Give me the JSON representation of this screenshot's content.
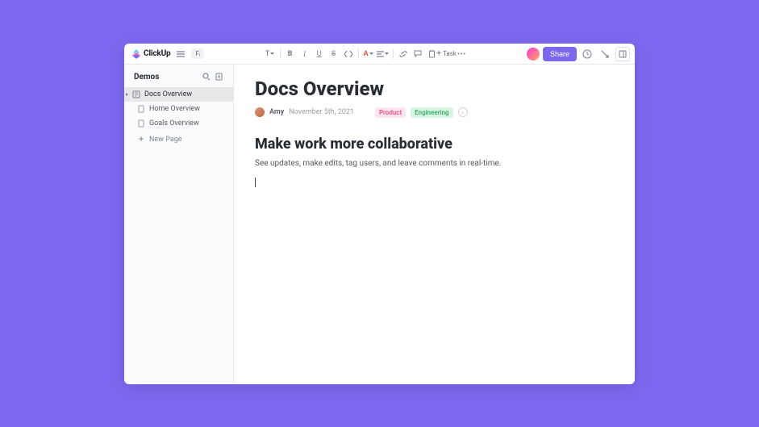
{
  "brand": {
    "name": "ClickUp"
  },
  "topbar": {
    "pill": "Fᵢ",
    "task_label": "Task",
    "share_label": "Share"
  },
  "sidebar": {
    "title": "Demos",
    "items": [
      {
        "label": "Docs Overview",
        "type": "doc",
        "active": true,
        "caret": true
      },
      {
        "label": "Home Overview",
        "type": "page",
        "active": false,
        "caret": false
      },
      {
        "label": "Goals Overview",
        "type": "page",
        "active": false,
        "caret": false
      }
    ],
    "new_label": "New Page"
  },
  "doc": {
    "title": "Docs Overview",
    "author": "Amy",
    "date": "November 5th, 2021",
    "tags": [
      {
        "label": "Product",
        "color": "pink"
      },
      {
        "label": "Engineering",
        "color": "green"
      }
    ],
    "h2": "Make work more collaborative",
    "body": "See updates, make edits, tag users, and leave comments in real-time."
  }
}
